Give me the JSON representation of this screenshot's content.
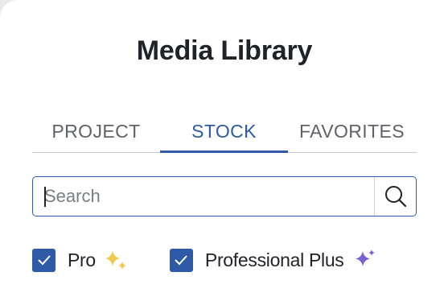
{
  "panel": {
    "title": "Media Library"
  },
  "tabs": [
    {
      "label": "PROJECT",
      "active": false
    },
    {
      "label": "STOCK",
      "active": true
    },
    {
      "label": "FAVORITES",
      "active": false
    }
  ],
  "search": {
    "value": "",
    "placeholder": "Search",
    "icon": "search-icon"
  },
  "filters": [
    {
      "label": "Pro",
      "checked": true,
      "icon": "sparkle-icon",
      "icon_color": "#f2c94c"
    },
    {
      "label": "Professional Plus",
      "checked": true,
      "icon": "sparkle-icon",
      "icon_color": "#7b5fd6"
    }
  ],
  "colors": {
    "accent": "#2e5aa8",
    "text": "#1f2227",
    "muted": "#5f6368"
  }
}
